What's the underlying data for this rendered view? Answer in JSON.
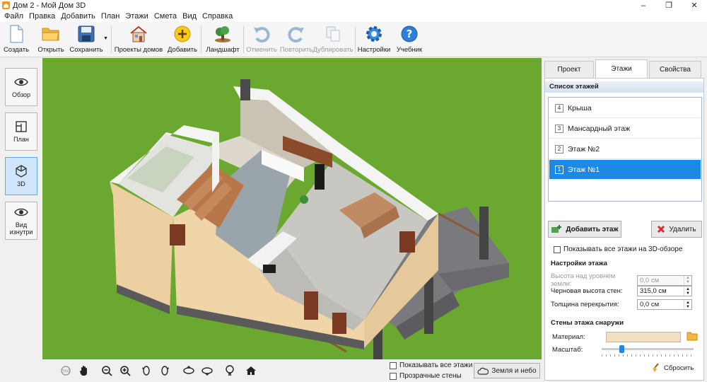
{
  "window": {
    "title": "Дом 2 - Мой Дом 3D",
    "controls": [
      "–",
      "❐",
      "✕"
    ]
  },
  "menu": [
    "Файл",
    "Правка",
    "Добавить",
    "План",
    "Этажи",
    "Смета",
    "Вид",
    "Справка"
  ],
  "toolbar": {
    "create": "Создать",
    "open": "Открыть",
    "save": "Сохранить",
    "projects": "Проекты домов",
    "add": "Добавить",
    "landscape": "Ландшафт",
    "undo": "Отменить",
    "redo": "Повторить",
    "duplicate": "Дублировать",
    "settings": "Настройки",
    "tutorial": "Учебник"
  },
  "modes": {
    "overview": "Обзор",
    "plan": "План",
    "view3d": "3D",
    "inside": "Вид изнутри"
  },
  "bottom": {
    "show_all_floors": "Показывать все этажи",
    "transparent_walls": "Прозрачные стены",
    "earth_sky": "Земля и небо"
  },
  "tabs": [
    "Проект",
    "Этажи",
    "Свойства"
  ],
  "floors_panel": {
    "list_header": "Список этажей",
    "floors": [
      {
        "num": "4",
        "name": "Крыша"
      },
      {
        "num": "3",
        "name": "Мансардный этаж"
      },
      {
        "num": "2",
        "name": "Этаж №2"
      },
      {
        "num": "1",
        "name": "Этаж №1"
      }
    ],
    "selected_index": 3,
    "add_floor": "Добавить этаж",
    "delete": "Удалить",
    "show_all_3d": "Показывать все этажи на 3D-обзоре",
    "settings_header": "Настройки этажа",
    "height_label": "Высота над уровнем земли:",
    "height_value": "0,0 см",
    "rough_height_label": "Черновая высота стен:",
    "rough_height_value": "315,0 см",
    "slab_label": "Толщина перекрытия:",
    "slab_value": "0,0 см",
    "walls_header": "Стены этажа снаружи",
    "material_label": "Материал:",
    "scale_label": "Масштаб:",
    "reset": "Сбросить",
    "scale_level": 0.2,
    "material_color": "#f2dfc2"
  },
  "colors": {
    "grass": "#6ba82f",
    "accent": "#1e88e5"
  }
}
